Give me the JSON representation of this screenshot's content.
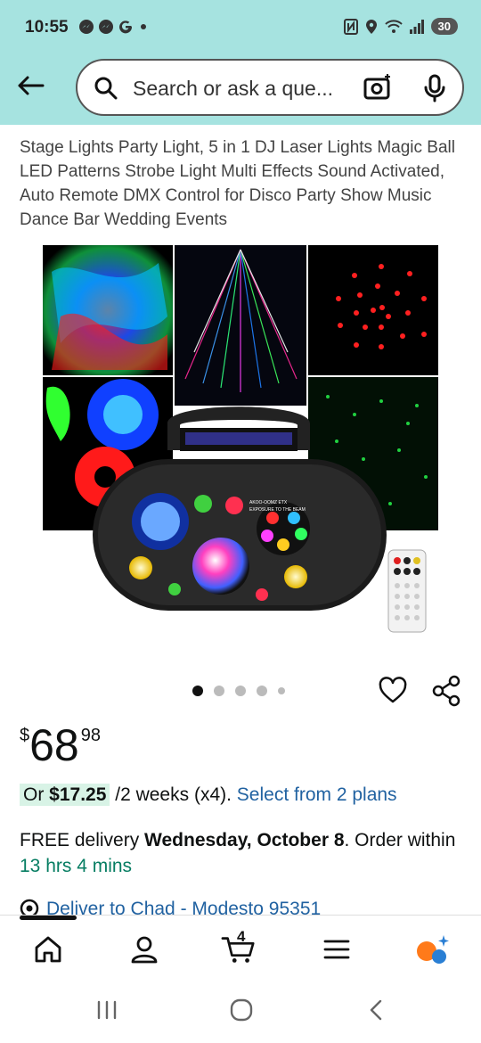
{
  "status": {
    "time": "10:55",
    "battery": "30"
  },
  "search": {
    "placeholder": "Search or ask a que..."
  },
  "product": {
    "title": "Stage Lights Party Light, 5 in 1 DJ Laser Lights Magic Ball LED Patterns Strobe Light Multi Effects Sound Activated, Auto Remote DMX Control for Disco Party Show Music Dance Bar Wedding Events",
    "image_label": "AKOO-OOMZ ETX\nEXPOSURE TO THE BEAM"
  },
  "price": {
    "currency": "$",
    "whole": "68",
    "fraction": "98"
  },
  "installment": {
    "prefix": "Or ",
    "amount": "$17.25",
    "period": " /2 weeks (x4). ",
    "link": "Select from 2 plans"
  },
  "delivery": {
    "free": "FREE delivery ",
    "date": "Wednesday, October 8",
    "order": ". Order within ",
    "countdown": "13 hrs 4 mins"
  },
  "deliver_to": {
    "text": "Deliver to Chad - Modesto 95351"
  },
  "tabbar": {
    "cart_count": "4"
  },
  "colors": {
    "header_bg": "#a6e3e0",
    "link": "#2162a1",
    "green": "#067d62"
  },
  "carousel": {
    "total": 5,
    "active": 0
  }
}
